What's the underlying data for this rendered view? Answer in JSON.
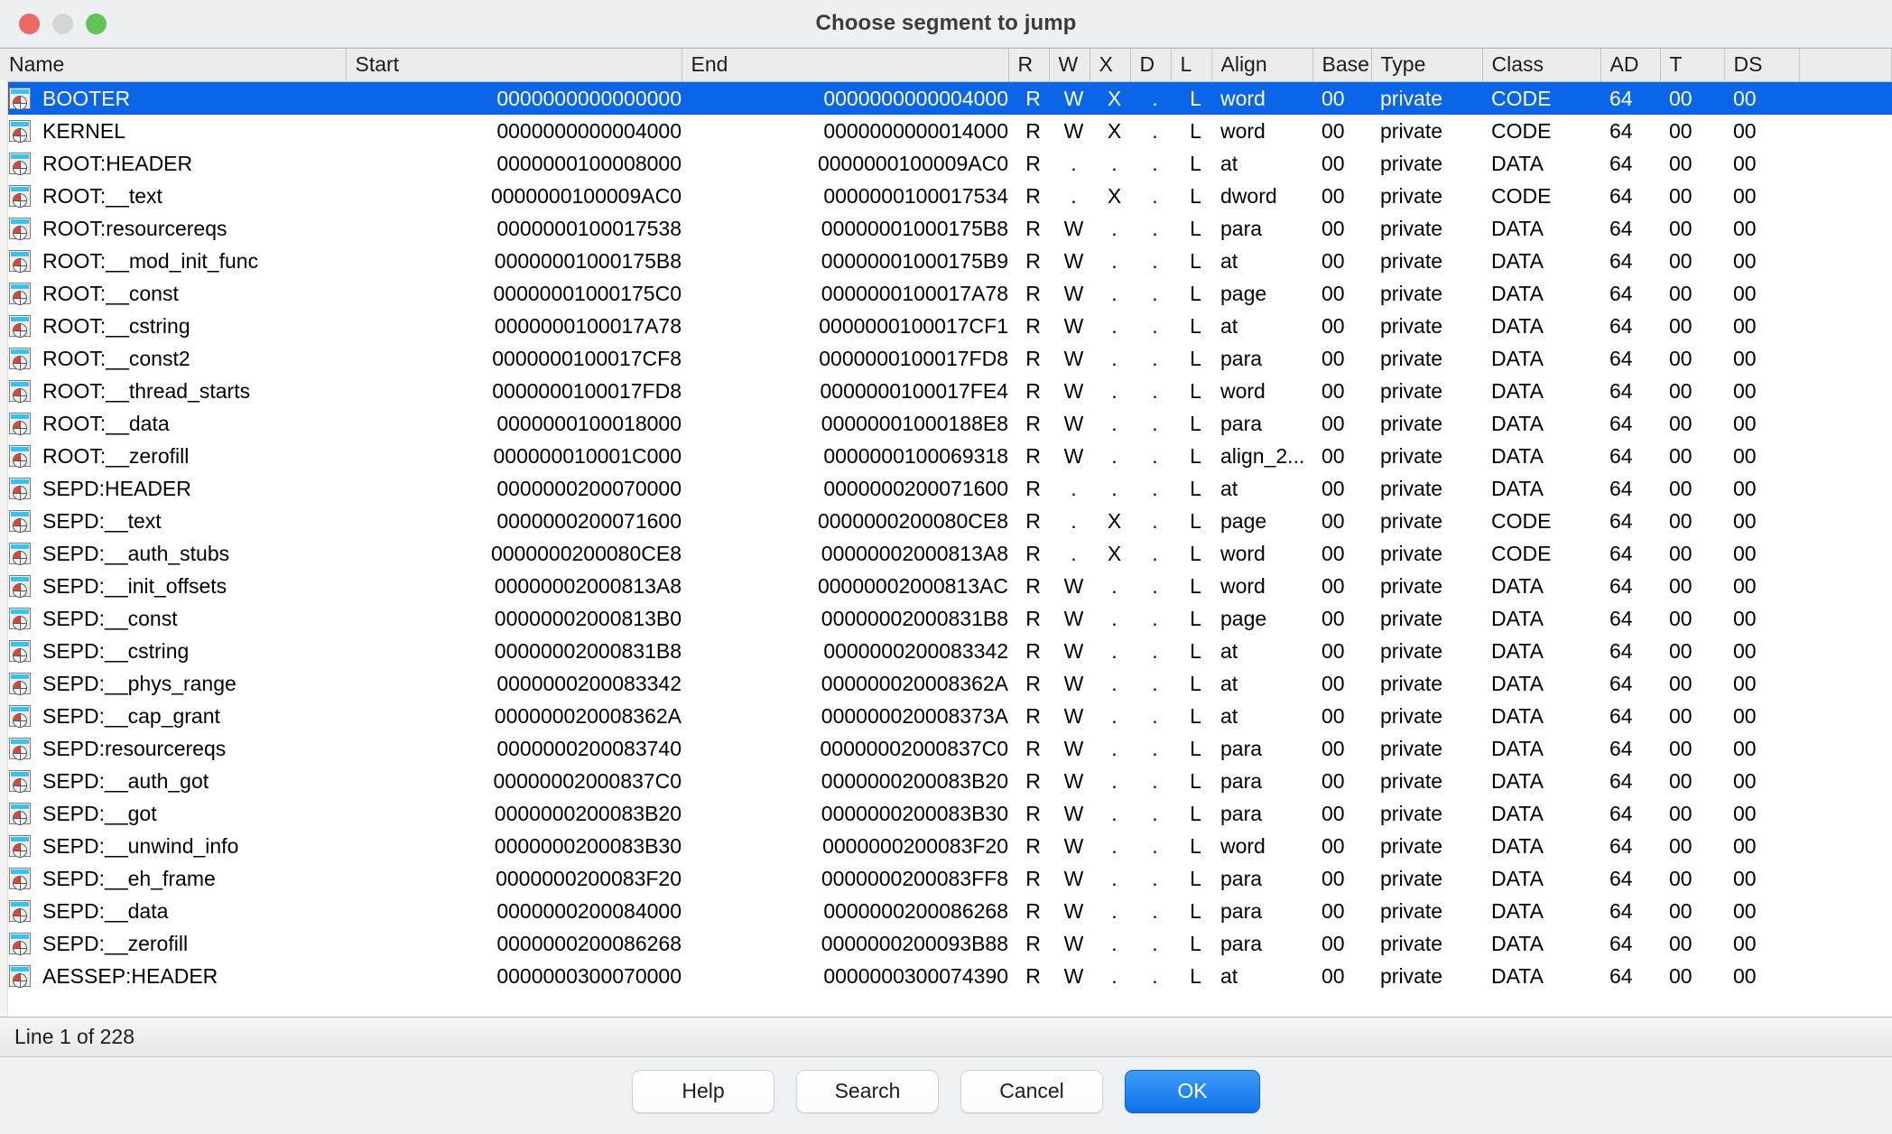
{
  "window": {
    "title": "Choose segment to jump",
    "controls": [
      "close",
      "minimize",
      "maximize"
    ]
  },
  "table": {
    "columns": [
      {
        "key": "name",
        "label": "Name"
      },
      {
        "key": "start",
        "label": "Start"
      },
      {
        "key": "end",
        "label": "End"
      },
      {
        "key": "r",
        "label": "R"
      },
      {
        "key": "w",
        "label": "W"
      },
      {
        "key": "x",
        "label": "X"
      },
      {
        "key": "d",
        "label": "D"
      },
      {
        "key": "l",
        "label": "L"
      },
      {
        "key": "align",
        "label": "Align"
      },
      {
        "key": "base",
        "label": "Base"
      },
      {
        "key": "type",
        "label": "Type"
      },
      {
        "key": "class",
        "label": "Class"
      },
      {
        "key": "ad",
        "label": "AD"
      },
      {
        "key": "t",
        "label": "T"
      },
      {
        "key": "ds",
        "label": "DS"
      }
    ],
    "selected_index": 0,
    "rows": [
      {
        "icon": "segment-icon",
        "name": "BOOTER",
        "start": "0000000000000000",
        "end": "0000000000004000",
        "r": "R",
        "w": "W",
        "x": "X",
        "d": ".",
        "l": "L",
        "align": "word",
        "base": "00",
        "type": "private",
        "class": "CODE",
        "ad": "64",
        "t": "00",
        "ds": "00"
      },
      {
        "icon": "segment-icon",
        "name": "KERNEL",
        "start": "0000000000004000",
        "end": "0000000000014000",
        "r": "R",
        "w": "W",
        "x": "X",
        "d": ".",
        "l": "L",
        "align": "word",
        "base": "00",
        "type": "private",
        "class": "CODE",
        "ad": "64",
        "t": "00",
        "ds": "00"
      },
      {
        "icon": "segment-icon",
        "name": "ROOT:HEADER",
        "start": "0000000100008000",
        "end": "0000000100009AC0",
        "r": "R",
        "w": ".",
        "x": ".",
        "d": ".",
        "l": "L",
        "align": "at",
        "base": "00",
        "type": "private",
        "class": "DATA",
        "ad": "64",
        "t": "00",
        "ds": "00"
      },
      {
        "icon": "segment-icon",
        "name": "ROOT:__text",
        "start": "0000000100009AC0",
        "end": "0000000100017534",
        "r": "R",
        "w": ".",
        "x": "X",
        "d": ".",
        "l": "L",
        "align": "dword",
        "base": "00",
        "type": "private",
        "class": "CODE",
        "ad": "64",
        "t": "00",
        "ds": "00"
      },
      {
        "icon": "segment-icon",
        "name": "ROOT:resourcereqs",
        "start": "0000000100017538",
        "end": "00000001000175B8",
        "r": "R",
        "w": "W",
        "x": ".",
        "d": ".",
        "l": "L",
        "align": "para",
        "base": "00",
        "type": "private",
        "class": "DATA",
        "ad": "64",
        "t": "00",
        "ds": "00"
      },
      {
        "icon": "segment-icon",
        "name": "ROOT:__mod_init_func",
        "start": "00000001000175B8",
        "end": "00000001000175B9",
        "r": "R",
        "w": "W",
        "x": ".",
        "d": ".",
        "l": "L",
        "align": "at",
        "base": "00",
        "type": "private",
        "class": "DATA",
        "ad": "64",
        "t": "00",
        "ds": "00"
      },
      {
        "icon": "segment-icon",
        "name": "ROOT:__const",
        "start": "00000001000175C0",
        "end": "0000000100017A78",
        "r": "R",
        "w": "W",
        "x": ".",
        "d": ".",
        "l": "L",
        "align": "page",
        "base": "00",
        "type": "private",
        "class": "DATA",
        "ad": "64",
        "t": "00",
        "ds": "00"
      },
      {
        "icon": "segment-icon",
        "name": "ROOT:__cstring",
        "start": "0000000100017A78",
        "end": "0000000100017CF1",
        "r": "R",
        "w": "W",
        "x": ".",
        "d": ".",
        "l": "L",
        "align": "at",
        "base": "00",
        "type": "private",
        "class": "DATA",
        "ad": "64",
        "t": "00",
        "ds": "00"
      },
      {
        "icon": "segment-icon",
        "name": "ROOT:__const2",
        "start": "0000000100017CF8",
        "end": "0000000100017FD8",
        "r": "R",
        "w": "W",
        "x": ".",
        "d": ".",
        "l": "L",
        "align": "para",
        "base": "00",
        "type": "private",
        "class": "DATA",
        "ad": "64",
        "t": "00",
        "ds": "00"
      },
      {
        "icon": "segment-icon",
        "name": "ROOT:__thread_starts",
        "start": "0000000100017FD8",
        "end": "0000000100017FE4",
        "r": "R",
        "w": "W",
        "x": ".",
        "d": ".",
        "l": "L",
        "align": "word",
        "base": "00",
        "type": "private",
        "class": "DATA",
        "ad": "64",
        "t": "00",
        "ds": "00"
      },
      {
        "icon": "segment-icon",
        "name": "ROOT:__data",
        "start": "0000000100018000",
        "end": "00000001000188E8",
        "r": "R",
        "w": "W",
        "x": ".",
        "d": ".",
        "l": "L",
        "align": "para",
        "base": "00",
        "type": "private",
        "class": "DATA",
        "ad": "64",
        "t": "00",
        "ds": "00"
      },
      {
        "icon": "segment-icon",
        "name": "ROOT:__zerofill",
        "start": "000000010001C000",
        "end": "0000000100069318",
        "r": "R",
        "w": "W",
        "x": ".",
        "d": ".",
        "l": "L",
        "align": "align_2...",
        "base": "00",
        "type": "private",
        "class": "DATA",
        "ad": "64",
        "t": "00",
        "ds": "00"
      },
      {
        "icon": "segment-icon",
        "name": "SEPD:HEADER",
        "start": "0000000200070000",
        "end": "0000000200071600",
        "r": "R",
        "w": ".",
        "x": ".",
        "d": ".",
        "l": "L",
        "align": "at",
        "base": "00",
        "type": "private",
        "class": "DATA",
        "ad": "64",
        "t": "00",
        "ds": "00"
      },
      {
        "icon": "segment-icon",
        "name": "SEPD:__text",
        "start": "0000000200071600",
        "end": "0000000200080CE8",
        "r": "R",
        "w": ".",
        "x": "X",
        "d": ".",
        "l": "L",
        "align": "page",
        "base": "00",
        "type": "private",
        "class": "CODE",
        "ad": "64",
        "t": "00",
        "ds": "00"
      },
      {
        "icon": "segment-icon",
        "name": "SEPD:__auth_stubs",
        "start": "0000000200080CE8",
        "end": "00000002000813A8",
        "r": "R",
        "w": ".",
        "x": "X",
        "d": ".",
        "l": "L",
        "align": "word",
        "base": "00",
        "type": "private",
        "class": "CODE",
        "ad": "64",
        "t": "00",
        "ds": "00"
      },
      {
        "icon": "segment-icon",
        "name": "SEPD:__init_offsets",
        "start": "00000002000813A8",
        "end": "00000002000813AC",
        "r": "R",
        "w": "W",
        "x": ".",
        "d": ".",
        "l": "L",
        "align": "word",
        "base": "00",
        "type": "private",
        "class": "DATA",
        "ad": "64",
        "t": "00",
        "ds": "00"
      },
      {
        "icon": "segment-icon",
        "name": "SEPD:__const",
        "start": "00000002000813B0",
        "end": "00000002000831B8",
        "r": "R",
        "w": "W",
        "x": ".",
        "d": ".",
        "l": "L",
        "align": "page",
        "base": "00",
        "type": "private",
        "class": "DATA",
        "ad": "64",
        "t": "00",
        "ds": "00"
      },
      {
        "icon": "segment-icon",
        "name": "SEPD:__cstring",
        "start": "00000002000831B8",
        "end": "0000000200083342",
        "r": "R",
        "w": "W",
        "x": ".",
        "d": ".",
        "l": "L",
        "align": "at",
        "base": "00",
        "type": "private",
        "class": "DATA",
        "ad": "64",
        "t": "00",
        "ds": "00"
      },
      {
        "icon": "segment-icon",
        "name": "SEPD:__phys_range",
        "start": "0000000200083342",
        "end": "000000020008362A",
        "r": "R",
        "w": "W",
        "x": ".",
        "d": ".",
        "l": "L",
        "align": "at",
        "base": "00",
        "type": "private",
        "class": "DATA",
        "ad": "64",
        "t": "00",
        "ds": "00"
      },
      {
        "icon": "segment-icon",
        "name": "SEPD:__cap_grant",
        "start": "000000020008362A",
        "end": "000000020008373A",
        "r": "R",
        "w": "W",
        "x": ".",
        "d": ".",
        "l": "L",
        "align": "at",
        "base": "00",
        "type": "private",
        "class": "DATA",
        "ad": "64",
        "t": "00",
        "ds": "00"
      },
      {
        "icon": "segment-icon",
        "name": "SEPD:resourcereqs",
        "start": "0000000200083740",
        "end": "00000002000837C0",
        "r": "R",
        "w": "W",
        "x": ".",
        "d": ".",
        "l": "L",
        "align": "para",
        "base": "00",
        "type": "private",
        "class": "DATA",
        "ad": "64",
        "t": "00",
        "ds": "00"
      },
      {
        "icon": "segment-icon",
        "name": "SEPD:__auth_got",
        "start": "00000002000837C0",
        "end": "0000000200083B20",
        "r": "R",
        "w": "W",
        "x": ".",
        "d": ".",
        "l": "L",
        "align": "para",
        "base": "00",
        "type": "private",
        "class": "DATA",
        "ad": "64",
        "t": "00",
        "ds": "00"
      },
      {
        "icon": "segment-icon",
        "name": "SEPD:__got",
        "start": "0000000200083B20",
        "end": "0000000200083B30",
        "r": "R",
        "w": "W",
        "x": ".",
        "d": ".",
        "l": "L",
        "align": "para",
        "base": "00",
        "type": "private",
        "class": "DATA",
        "ad": "64",
        "t": "00",
        "ds": "00"
      },
      {
        "icon": "segment-icon",
        "name": "SEPD:__unwind_info",
        "start": "0000000200083B30",
        "end": "0000000200083F20",
        "r": "R",
        "w": "W",
        "x": ".",
        "d": ".",
        "l": "L",
        "align": "word",
        "base": "00",
        "type": "private",
        "class": "DATA",
        "ad": "64",
        "t": "00",
        "ds": "00"
      },
      {
        "icon": "segment-icon",
        "name": "SEPD:__eh_frame",
        "start": "0000000200083F20",
        "end": "0000000200083FF8",
        "r": "R",
        "w": "W",
        "x": ".",
        "d": ".",
        "l": "L",
        "align": "para",
        "base": "00",
        "type": "private",
        "class": "DATA",
        "ad": "64",
        "t": "00",
        "ds": "00"
      },
      {
        "icon": "segment-icon",
        "name": "SEPD:__data",
        "start": "0000000200084000",
        "end": "0000000200086268",
        "r": "R",
        "w": "W",
        "x": ".",
        "d": ".",
        "l": "L",
        "align": "para",
        "base": "00",
        "type": "private",
        "class": "DATA",
        "ad": "64",
        "t": "00",
        "ds": "00"
      },
      {
        "icon": "segment-icon",
        "name": "SEPD:__zerofill",
        "start": "0000000200086268",
        "end": "0000000200093B88",
        "r": "R",
        "w": "W",
        "x": ".",
        "d": ".",
        "l": "L",
        "align": "para",
        "base": "00",
        "type": "private",
        "class": "DATA",
        "ad": "64",
        "t": "00",
        "ds": "00"
      },
      {
        "icon": "segment-icon",
        "name": "AESSEP:HEADER",
        "start": "0000000300070000",
        "end": "0000000300074390",
        "r": "R",
        "w": "W",
        "x": ".",
        "d": ".",
        "l": "L",
        "align": "at",
        "base": "00",
        "type": "private",
        "class": "DATA",
        "ad": "64",
        "t": "00",
        "ds": "00"
      }
    ]
  },
  "statusbar": {
    "text": "Line 1 of 228"
  },
  "buttons": {
    "help": "Help",
    "search": "Search",
    "cancel": "Cancel",
    "ok": "OK"
  },
  "colors": {
    "selection": "#0a65e8",
    "primary_button": "#0f72ec",
    "icon_bar": "#35c3f0",
    "icon_quadrant": "#f0402a"
  }
}
